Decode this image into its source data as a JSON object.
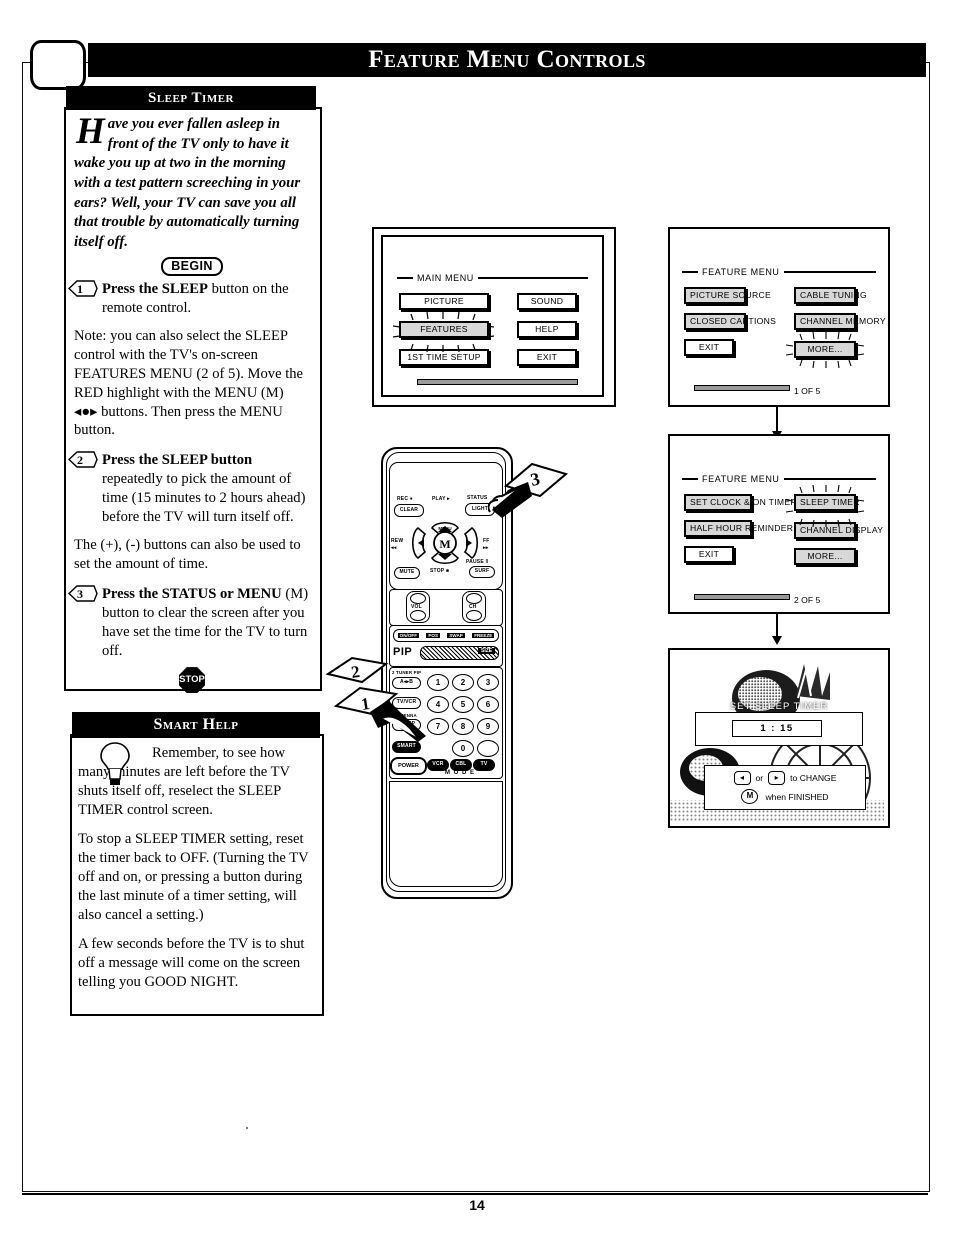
{
  "header": {
    "title": "Feature Menu Controls",
    "tv_icon": "tv-screen-icon"
  },
  "left_panel": {
    "title": "Sleep Timer",
    "intro_dropcap": "H",
    "intro": "ave you ever fallen asleep in front of the TV only to have it wake you up at two in the morning with a test pattern screeching in your ears?  Well, your TV can save you all that trouble by automatically turning itself off.",
    "begin_label": "BEGIN",
    "steps": [
      {
        "number": "1",
        "bold_lead": "Press the SLEEP",
        "text": " button on the remote control."
      },
      {
        "number": "2",
        "bold_lead": "Press the SLEEP button",
        "text": " repeatedly to pick the amount of time (15 minutes to 2 hours ahead) before the TV will turn itself off."
      },
      {
        "number": "3",
        "bold_lead": "Press the STATUS or MENU",
        "text": " (M) button to clear the screen after you have set the time for the TV to turn off."
      }
    ],
    "note": "Note: you can also select the SLEEP control with the TV's on-screen FEATURES MENU (2 of 5). Move the RED highlight with the MENU (M) ◂●▸ buttons. Then press the MENU button.",
    "plus_minus_note": "The (+), (-) buttons can also be used to set the amount of time.",
    "stop_label": "STOP"
  },
  "smart_help": {
    "title": "Smart Help",
    "icon": "lightbulb-icon",
    "paragraphs": [
      "Remember, to see how many minutes are left before the TV shuts itself off, reselect the SLEEP TIMER control screen.",
      "To stop a SLEEP TIMER setting, reset the timer back to OFF. (Turning the TV off and on, or pressing a button during the last minute of a timer setting, will also cancel a setting.)",
      "A few seconds before the TV is to shut off a message will come on the screen telling you GOOD NIGHT."
    ],
    "italic_tail": "GOOD NIGHT"
  },
  "screens": {
    "main_menu": {
      "heading": "MAIN MENU",
      "left_buttons": [
        "PICTURE",
        "FEATURES",
        "1ST TIME SETUP"
      ],
      "right_buttons": [
        "SOUND",
        "HELP",
        "EXIT"
      ],
      "highlighted": "FEATURES",
      "page_indicator": ""
    },
    "feature_menu_1": {
      "heading": "FEATURE MENU",
      "left_buttons": [
        "PICTURE SOURCE",
        "CLOSED CAPTIONS",
        "EXIT"
      ],
      "right_buttons": [
        "CABLE TUNING",
        "CHANNEL MEMORY",
        "MORE..."
      ],
      "highlighted": "MORE...",
      "page_indicator": "1 OF 5"
    },
    "feature_menu_2": {
      "heading": "FEATURE MENU",
      "left_buttons": [
        "SET CLOCK & ON TIMER",
        "HALF HOUR REMINDER",
        "EXIT"
      ],
      "right_buttons": [
        "SLEEP TIMER",
        "CHANNEL DISPLAY",
        "MORE..."
      ],
      "highlighted": "SLEEP TIMER",
      "page_indicator": "2 OF 5"
    },
    "set_sleep_timer": {
      "heading": "SET SLEEP TIMER",
      "value": "1 : 15",
      "hint_change": "to CHANGE",
      "hint_change_left_icon": "left-arrow-icon",
      "hint_change_or": "or",
      "hint_change_right_icon": "right-arrow-icon",
      "hint_finished_icon": "M",
      "hint_finished": "when FINISHED"
    }
  },
  "remote": {
    "name": "remote-control",
    "top_row": [
      {
        "label": "REC ●",
        "button": "CLEAR"
      },
      {
        "label": "PLAY ▸",
        "button": ""
      },
      {
        "label": "STATUS",
        "button": "LIGHT"
      }
    ],
    "side_left": {
      "label": "REW\n◂◂",
      "button": "MUTE"
    },
    "side_right": {
      "label": "FF\n▸▸",
      "button": "SURF"
    },
    "dpad_center": "M",
    "dpad_center_label": "MENU",
    "dpad_up_label": "PLAY ▸",
    "dpad_down_label": "STOP ■",
    "pause_label": "PAUSE ‖",
    "vol_label": "VOL",
    "ch_label": "CH",
    "pip_row": [
      "ON/OFF",
      "POS",
      "SWAP",
      "FREEZE"
    ],
    "pip_title": "PIP",
    "pip_size": "SIZE",
    "two_tuner_label": "2 TUNER PIP",
    "two_tuner_button": "A◂▸B",
    "tv_vcr_button": "TV/VCR",
    "sleep_label": "ANTENNA",
    "sleep_button": "SLEEP",
    "smart_button": "SMART",
    "power_button": "POWER",
    "mode_buttons": [
      "VCR",
      "CBL",
      "TV"
    ],
    "mode_label": "M O D E",
    "keypad": [
      "1",
      "2",
      "3",
      "4",
      "5",
      "6",
      "7",
      "8",
      "9",
      "0"
    ]
  },
  "callouts": [
    {
      "number": "1",
      "target": "sleep-button"
    },
    {
      "number": "2",
      "target": "sleep-button"
    },
    {
      "number": "3",
      "target": "status-light-button"
    }
  ],
  "footer": {
    "page_number": "14"
  },
  "colors": {
    "ink": "#000000",
    "paper": "#ffffff",
    "screen_gray": "#9a9a9a"
  }
}
